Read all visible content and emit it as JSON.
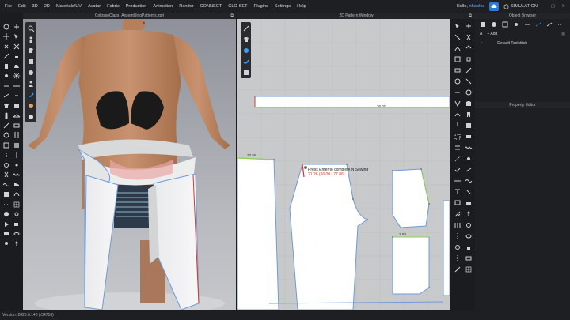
{
  "menu": [
    "File",
    "Edit",
    "3D",
    "2D",
    "Materials/UV",
    "Avatar",
    "Fabric",
    "Production",
    "Animation",
    "Render",
    "CONNECT",
    "CLO-SET",
    "Plugins",
    "Settings",
    "Help"
  ],
  "header_right": {
    "hello": "Hello,",
    "user": "nftables",
    "simulation": "SIMULATION"
  },
  "viewport3d": {
    "title": "ColossoClass_AssemblingPatterns.zprj"
  },
  "pattern_window": {
    "title": "2D Pattern Window",
    "tooltip": "Press Enter to complete N Sewing",
    "tooltip_measure": "21.26 (66.00 / 77.86)",
    "labels": {
      "band_length": "36.00",
      "left_top": "23.58",
      "right_piece": "3.58"
    }
  },
  "object_browser": {
    "title": "Object Browser",
    "add_label": "Add",
    "item": "Default Toolstitch"
  },
  "property_editor": {
    "title": "Property Editor"
  },
  "status_bar": {
    "version": "Version: 2025.0.148 (r54718)"
  },
  "colors": {
    "accent": "#2d79d6",
    "link": "#6aa8ff",
    "measure": "#e0342a",
    "sewing_line": "#8fd14f"
  }
}
